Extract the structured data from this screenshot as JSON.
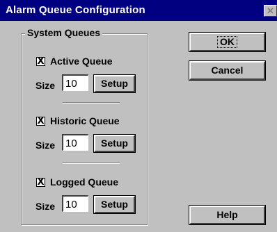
{
  "window": {
    "title": "Alarm Queue Configuration",
    "close_glyph": "✕"
  },
  "group": {
    "title": "System Queues"
  },
  "queues": [
    {
      "label": "Active Queue",
      "checked": true,
      "check_glyph": "X",
      "size_label": "Size",
      "size_value": "10",
      "setup_label": "Setup"
    },
    {
      "label": "Historic Queue",
      "checked": true,
      "check_glyph": "X",
      "size_label": "Size",
      "size_value": "10",
      "setup_label": "Setup"
    },
    {
      "label": "Logged Queue",
      "checked": true,
      "check_glyph": "X",
      "size_label": "Size",
      "size_value": "10",
      "setup_label": "Setup"
    }
  ],
  "buttons": {
    "ok": "OK",
    "cancel": "Cancel",
    "help": "Help"
  },
  "icons": {
    "close": "close-icon",
    "checkbox": "checkbox-check-icon"
  },
  "colors": {
    "titlebar": "#000080",
    "face": "#c0c0c0"
  }
}
